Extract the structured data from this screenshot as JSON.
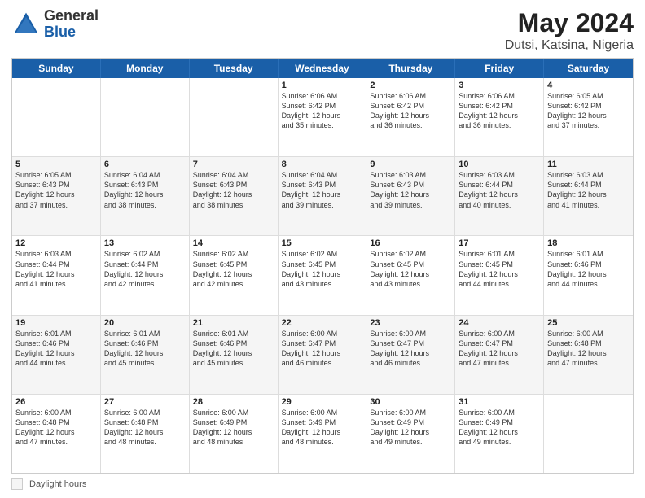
{
  "logo": {
    "general": "General",
    "blue": "Blue"
  },
  "title": "May 2024",
  "subtitle": "Dutsi, Katsina, Nigeria",
  "days_of_week": [
    "Sunday",
    "Monday",
    "Tuesday",
    "Wednesday",
    "Thursday",
    "Friday",
    "Saturday"
  ],
  "weeks": [
    [
      {
        "num": "",
        "info": ""
      },
      {
        "num": "",
        "info": ""
      },
      {
        "num": "",
        "info": ""
      },
      {
        "num": "1",
        "info": "Sunrise: 6:06 AM\nSunset: 6:42 PM\nDaylight: 12 hours\nand 35 minutes."
      },
      {
        "num": "2",
        "info": "Sunrise: 6:06 AM\nSunset: 6:42 PM\nDaylight: 12 hours\nand 36 minutes."
      },
      {
        "num": "3",
        "info": "Sunrise: 6:06 AM\nSunset: 6:42 PM\nDaylight: 12 hours\nand 36 minutes."
      },
      {
        "num": "4",
        "info": "Sunrise: 6:05 AM\nSunset: 6:42 PM\nDaylight: 12 hours\nand 37 minutes."
      }
    ],
    [
      {
        "num": "5",
        "info": "Sunrise: 6:05 AM\nSunset: 6:43 PM\nDaylight: 12 hours\nand 37 minutes."
      },
      {
        "num": "6",
        "info": "Sunrise: 6:04 AM\nSunset: 6:43 PM\nDaylight: 12 hours\nand 38 minutes."
      },
      {
        "num": "7",
        "info": "Sunrise: 6:04 AM\nSunset: 6:43 PM\nDaylight: 12 hours\nand 38 minutes."
      },
      {
        "num": "8",
        "info": "Sunrise: 6:04 AM\nSunset: 6:43 PM\nDaylight: 12 hours\nand 39 minutes."
      },
      {
        "num": "9",
        "info": "Sunrise: 6:03 AM\nSunset: 6:43 PM\nDaylight: 12 hours\nand 39 minutes."
      },
      {
        "num": "10",
        "info": "Sunrise: 6:03 AM\nSunset: 6:44 PM\nDaylight: 12 hours\nand 40 minutes."
      },
      {
        "num": "11",
        "info": "Sunrise: 6:03 AM\nSunset: 6:44 PM\nDaylight: 12 hours\nand 41 minutes."
      }
    ],
    [
      {
        "num": "12",
        "info": "Sunrise: 6:03 AM\nSunset: 6:44 PM\nDaylight: 12 hours\nand 41 minutes."
      },
      {
        "num": "13",
        "info": "Sunrise: 6:02 AM\nSunset: 6:44 PM\nDaylight: 12 hours\nand 42 minutes."
      },
      {
        "num": "14",
        "info": "Sunrise: 6:02 AM\nSunset: 6:45 PM\nDaylight: 12 hours\nand 42 minutes."
      },
      {
        "num": "15",
        "info": "Sunrise: 6:02 AM\nSunset: 6:45 PM\nDaylight: 12 hours\nand 43 minutes."
      },
      {
        "num": "16",
        "info": "Sunrise: 6:02 AM\nSunset: 6:45 PM\nDaylight: 12 hours\nand 43 minutes."
      },
      {
        "num": "17",
        "info": "Sunrise: 6:01 AM\nSunset: 6:45 PM\nDaylight: 12 hours\nand 44 minutes."
      },
      {
        "num": "18",
        "info": "Sunrise: 6:01 AM\nSunset: 6:46 PM\nDaylight: 12 hours\nand 44 minutes."
      }
    ],
    [
      {
        "num": "19",
        "info": "Sunrise: 6:01 AM\nSunset: 6:46 PM\nDaylight: 12 hours\nand 44 minutes."
      },
      {
        "num": "20",
        "info": "Sunrise: 6:01 AM\nSunset: 6:46 PM\nDaylight: 12 hours\nand 45 minutes."
      },
      {
        "num": "21",
        "info": "Sunrise: 6:01 AM\nSunset: 6:46 PM\nDaylight: 12 hours\nand 45 minutes."
      },
      {
        "num": "22",
        "info": "Sunrise: 6:00 AM\nSunset: 6:47 PM\nDaylight: 12 hours\nand 46 minutes."
      },
      {
        "num": "23",
        "info": "Sunrise: 6:00 AM\nSunset: 6:47 PM\nDaylight: 12 hours\nand 46 minutes."
      },
      {
        "num": "24",
        "info": "Sunrise: 6:00 AM\nSunset: 6:47 PM\nDaylight: 12 hours\nand 47 minutes."
      },
      {
        "num": "25",
        "info": "Sunrise: 6:00 AM\nSunset: 6:48 PM\nDaylight: 12 hours\nand 47 minutes."
      }
    ],
    [
      {
        "num": "26",
        "info": "Sunrise: 6:00 AM\nSunset: 6:48 PM\nDaylight: 12 hours\nand 47 minutes."
      },
      {
        "num": "27",
        "info": "Sunrise: 6:00 AM\nSunset: 6:48 PM\nDaylight: 12 hours\nand 48 minutes."
      },
      {
        "num": "28",
        "info": "Sunrise: 6:00 AM\nSunset: 6:49 PM\nDaylight: 12 hours\nand 48 minutes."
      },
      {
        "num": "29",
        "info": "Sunrise: 6:00 AM\nSunset: 6:49 PM\nDaylight: 12 hours\nand 48 minutes."
      },
      {
        "num": "30",
        "info": "Sunrise: 6:00 AM\nSunset: 6:49 PM\nDaylight: 12 hours\nand 49 minutes."
      },
      {
        "num": "31",
        "info": "Sunrise: 6:00 AM\nSunset: 6:49 PM\nDaylight: 12 hours\nand 49 minutes."
      },
      {
        "num": "",
        "info": ""
      }
    ]
  ],
  "footer": {
    "daylight_label": "Daylight hours"
  }
}
